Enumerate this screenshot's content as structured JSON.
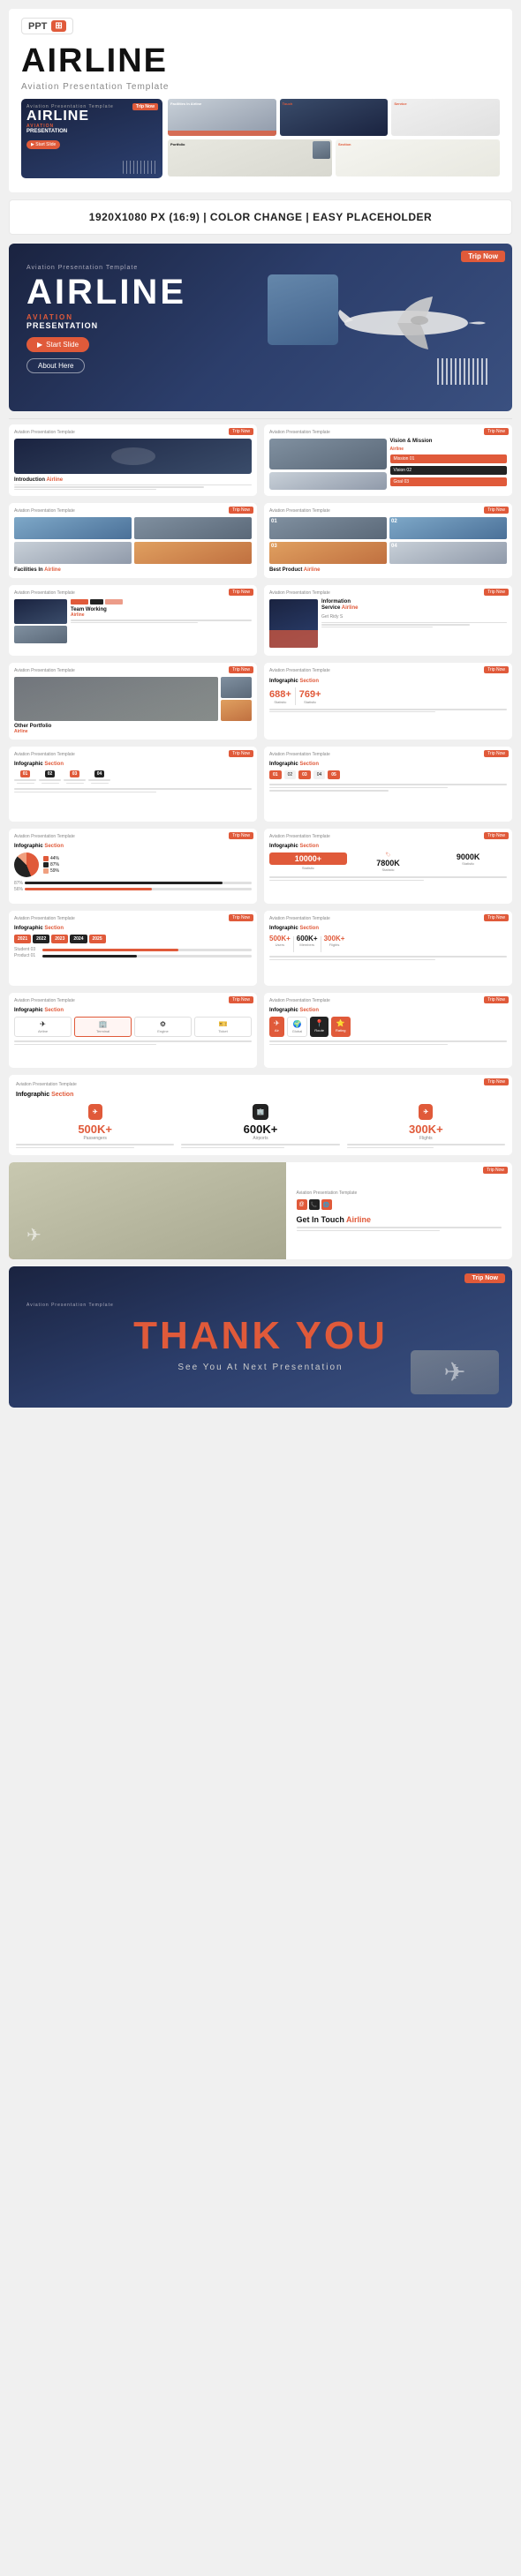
{
  "header": {
    "ppt_label": "PPT",
    "file_icon_label": "📊",
    "main_title": "AIRLINE",
    "subtitle": "Aviation Presentation Template",
    "info_banner": "1920X1080 PX (16:9) | COLOR CHANGE | EASY PLACEHOLDER"
  },
  "featured_slide": {
    "brand_label": "Aviation Presentation Template",
    "trip_badge": "Trip Now",
    "airline_text": "AIRLINE",
    "aviation_label": "AVIATION",
    "presentation_label": "PRESENTATION",
    "start_btn": "Start Slide",
    "about_btn": "About Here"
  },
  "slides": [
    {
      "id": "intro",
      "title": "Introduction Airline",
      "tag": "Trip Now"
    },
    {
      "id": "vision",
      "title": "Vision & Mission Airline",
      "tag": "Trip Now"
    },
    {
      "id": "facilities",
      "title": "Facilities In Airline",
      "tag": "Trip Now"
    },
    {
      "id": "best-product",
      "title": "Best Product Airline",
      "tag": "Trip Now"
    },
    {
      "id": "team",
      "title": "Team Working Airline",
      "tag": "Trip Now"
    },
    {
      "id": "info-service",
      "title": "Information Service Airline",
      "tag": "Trip Now"
    },
    {
      "id": "portfolio",
      "title": "Other Portfolio Airline",
      "tag": "Trip Now"
    },
    {
      "id": "infographic1",
      "title": "Infographic Section",
      "tag": "Trip Now"
    },
    {
      "id": "infographic2",
      "title": "Infographic Section",
      "tag": "Trip Now"
    },
    {
      "id": "infographic3",
      "title": "Infographic Section",
      "tag": "Trip Now"
    },
    {
      "id": "infographic4",
      "title": "Infographic Section",
      "tag": "Trip Now"
    },
    {
      "id": "infographic5",
      "title": "Infographic Section",
      "tag": "Trip Now"
    },
    {
      "id": "infographic6",
      "title": "Infographic Section",
      "tag": "Trip Now"
    },
    {
      "id": "infographic7",
      "title": "Infographic Section",
      "tag": "Trip Now"
    },
    {
      "id": "infographic8",
      "title": "Infographic Section",
      "tag": "Trip Now"
    },
    {
      "id": "infographic9",
      "title": "Infographic Section",
      "tag": "Trip Now"
    },
    {
      "id": "infographic10",
      "title": "Infographic Section",
      "tag": "Trip Now"
    },
    {
      "id": "get-in-touch",
      "title": "Get In Touch Airline",
      "tag": "Trip Now"
    },
    {
      "id": "thank-you",
      "title": "Thank You",
      "tag": ""
    }
  ],
  "stats": {
    "stat1": "688+",
    "stat2": "769+",
    "stat3": "10000+",
    "stat4": "7800K",
    "stat5": "9000K",
    "pct1": "44%",
    "pct2": "59%",
    "pct3": "87%",
    "pct4": "56%",
    "year1": "2021",
    "year2": "2022",
    "year3": "2023",
    "year4": "2024",
    "year5": "2025"
  },
  "thank_you": {
    "main_text": "THANK YOU",
    "sub_text": "See You At Next Presentation"
  },
  "colors": {
    "accent": "#e05a3a",
    "dark": "#1a2340",
    "light_bg": "#f5f5f5",
    "text_dark": "#111111"
  }
}
